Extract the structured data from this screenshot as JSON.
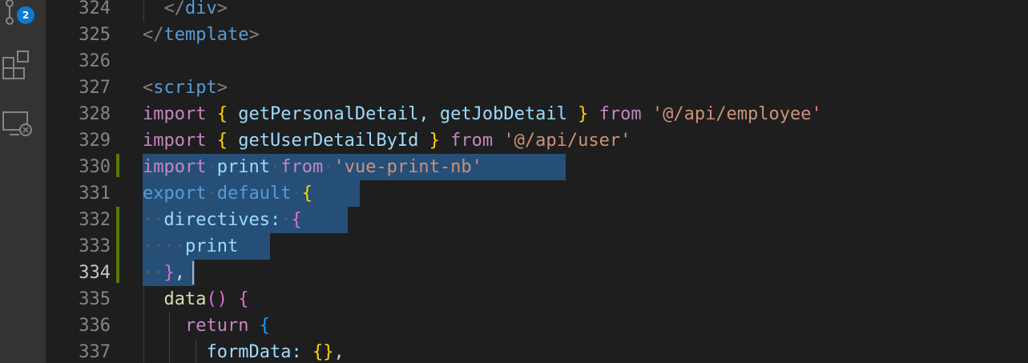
{
  "activity_bar": {
    "source_control_badge": "2",
    "icons": [
      "source-control-icon",
      "extensions-icon",
      "remote-explorer-icon"
    ]
  },
  "editor": {
    "active_line": "334",
    "lines": [
      {
        "num": "324"
      },
      {
        "num": "325"
      },
      {
        "num": "326"
      },
      {
        "num": "327"
      },
      {
        "num": "328"
      },
      {
        "num": "329"
      },
      {
        "num": "330"
      },
      {
        "num": "331"
      },
      {
        "num": "332"
      },
      {
        "num": "333"
      },
      {
        "num": "334"
      },
      {
        "num": "335"
      },
      {
        "num": "336"
      },
      {
        "num": "337"
      }
    ],
    "tokens": {
      "l324": [
        "</",
        "div",
        ">"
      ],
      "l325": [
        "</",
        "template",
        ">"
      ],
      "l327": [
        "<",
        "script",
        ">"
      ],
      "l328": [
        "import",
        "{",
        "getPersonalDetail,",
        "getJobDetail",
        "}",
        "from",
        "'@/api/employee'"
      ],
      "l329": [
        "import",
        "{",
        "getUserDetailById",
        "}",
        "from",
        "'@/api/user'"
      ],
      "l330": [
        "import",
        "print",
        "from",
        "'vue-print-nb'"
      ],
      "l331": [
        "export",
        "default",
        "{"
      ],
      "l332": [
        "directives:",
        "{"
      ],
      "l333": [
        "print"
      ],
      "l334": [
        "}",
        ","
      ],
      "l335": [
        "data",
        "()",
        "{"
      ],
      "l336": [
        "return",
        "{"
      ],
      "l337": [
        "formData:",
        "{}",
        ","
      ]
    }
  },
  "colors": {
    "background": "#1e1e1e",
    "activity_bar": "#333333",
    "selection": "#264f78",
    "badge": "#0e7acf",
    "git_modified": "#587c0c"
  }
}
